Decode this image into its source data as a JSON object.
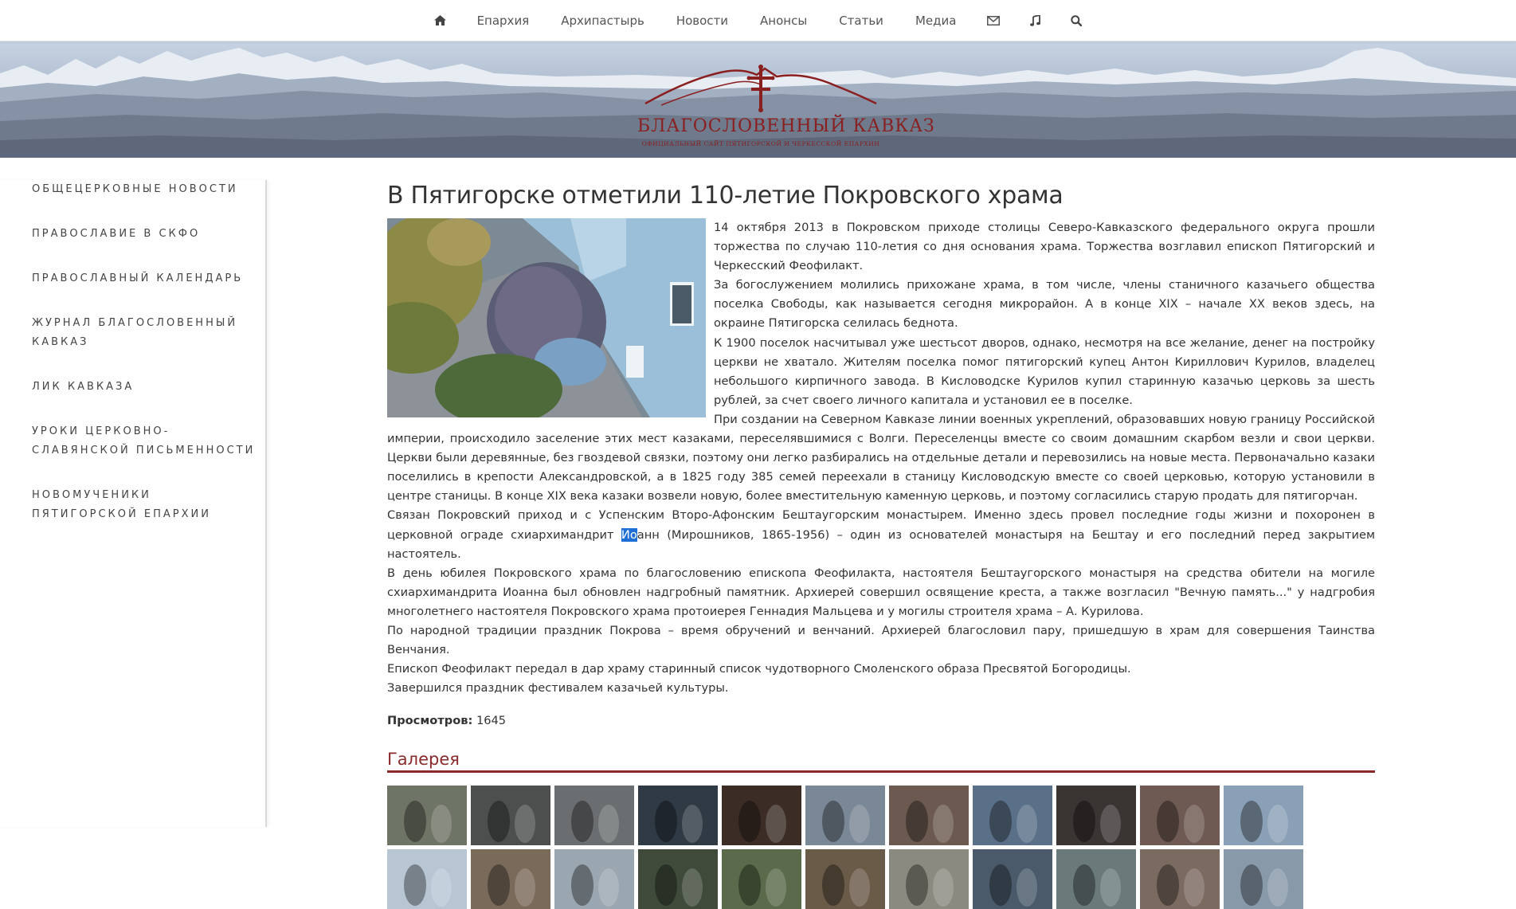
{
  "nav": {
    "home_icon": "home-icon",
    "items": [
      "Епархия",
      "Архипастырь",
      "Новости",
      "Анонсы",
      "Статьи",
      "Медиа"
    ],
    "mail_icon": "envelope-icon",
    "music_icon": "music-icon",
    "search_icon": "search-icon"
  },
  "banner": {
    "logo_title": "БЛАГОСЛОВЕННЫЙ КАВКАЗ",
    "logo_subtitle": "ОФИЦИАЛЬНЫЙ САЙТ ПЯТИГОРСКОЙ И ЧЕРКЕССКОЙ ЕПАРХИИ",
    "logo_color": "#8a1f1f"
  },
  "sidebar": {
    "items": [
      "ОБЩЕЦЕРКОВНЫЕ НОВОСТИ",
      "ПРАВОСЛАВИЕ В СКФО",
      "ПРАВОСЛАВНЫЙ КАЛЕНДАРЬ",
      "ЖУРНАЛ БЛАГОСЛОВЕННЫЙ КАВКАЗ",
      "ЛИК КАВКАЗА",
      "УРОКИ ЦЕРКОВНО-СЛАВЯНСКОЙ ПИСЬМЕННОСТИ",
      "НОВОМУЧЕНИКИ ПЯТИГОРСКОЙ ЕПАРХИИ"
    ]
  },
  "article": {
    "title": "В Пятигорске отметили 110-летие Покровского храма",
    "paragraphs": [
      "14 октября 2013 в Покровском приходе столицы Северо-Кавказского федерального округа прошли торжества по случаю 110-летия со дня основания храма. Торжества возглавил епископ Пятигорский и Черкесский Феофилакт.",
      "За богослужением молились прихожане храма, в том числе, члены станичного казачьего общества поселка Свободы, как называется сегодня микрорайон. А в конце XIX – начале XX веков здесь, на окраине Пятигорска селилась беднота.",
      "К 1900 поселок насчитывал уже шестьсот дворов, однако, несмотря на все желание, денег на постройку церкви не хватало. Жителям поселка помог пятигорский купец Антон Кириллович Курилов, владелец небольшого кирпичного завода. В Кисловодске Курилов купил старинную казачью церковь за шесть рублей, за счет своего личного капитала и установил ее в поселке.",
      "При создании на Северном Кавказе линии военных укреплений, образовавших новую границу Российской империи, происходило заселение этих мест казаками, переселявшимися с Волги. Переселенцы вместе со своим домашним скарбом везли и свои церкви. Церкви были деревянные, без гвоздевой связки, поэтому они легко разбирались на отдельные детали и перевозились на новые места. Первоначально казаки поселились в крепости Александровской, а в 1825 году 385 семей переехали в станицу Кисловодскую вместе со своей церковью, которую установили в центре станицы. В конце XIX века казаки возвели новую, более вместительную каменную церковь, и поэтому согласились старую продать для пятигорчан."
    ],
    "p5_before": "Связан Покровский приход и с Успенским Второ-Афонским Бештаугорским монастырем. Именно здесь провел последние годы жизни и похоронен в церковной ограде схиархимандрит ",
    "p5_selected": "Ио",
    "p5_after": "анн (Мирошников, 1865-1956) – один из основателей монастыря на Бештау и его последний перед закрытием настоятель.",
    "paragraphs_end": [
      "В день юбилея Покровского храма по благословению епископа Феофилакта, настоятеля Бештаугорского монастыря на средства обители на могиле схиархимандрита Иоанна был обновлен надгробный памятник. Архиерей совершил освящение креста, а также возгласил \"Вечную память...\" у надгробия многолетнего настоятеля Покровского храма протоиерея Геннадия Мальцева и у могилы строителя храма – А. Курилова.",
      "По народной традиции праздник Покрова – время обручений и венчаний. Архиерей благословил пару, пришедшую в храм для совершения Таинства Венчания.",
      "Епископ Феофилакт передал в дар храму старинный список чудотворного Смоленского образа Пресвятой Богородицы.",
      "Завершился праздник фестивалем казачьей культуры."
    ],
    "views_label": "Просмотров:",
    "views_count": "1645"
  },
  "gallery": {
    "title": "Галерея",
    "accent": "#8a2a2a",
    "thumb_colors": [
      "#6f7566",
      "#4d4f4f",
      "#6b6e70",
      "#2f3a44",
      "#3b2c25",
      "#7a8796",
      "#6c5a50",
      "#5a6f88",
      "#3a3433",
      "#6e5a52",
      "#8aa0b6",
      "#b8c6d4",
      "#7a6a5a",
      "#9aa6b0",
      "#3f4a3a",
      "#5a6a4a",
      "#6a5a48",
      "#8a8a80",
      "#4a5a6a",
      "#6a7a7a",
      "#7a6a60",
      "#8899aa"
    ]
  }
}
